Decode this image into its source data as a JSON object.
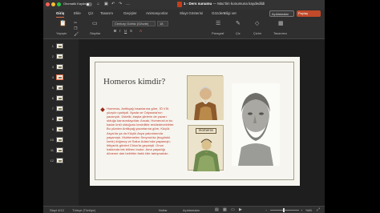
{
  "titlebar": {
    "autosave_label": "Otomatik Kaydet",
    "doc_title": "1 - Ders sunumu",
    "doc_status": "— Mac'tim konumuna kaydedildi"
  },
  "tabs": [
    {
      "label": "Giriş",
      "active": true
    },
    {
      "label": "Ekle"
    },
    {
      "label": "Çiz"
    },
    {
      "label": "Tasarım"
    },
    {
      "label": "Geçişler"
    },
    {
      "label": "Animasyonlar"
    },
    {
      "label": "Slayt Gösterisi"
    },
    {
      "label": "Gözden"
    },
    {
      "label": "Bilgi ver"
    }
  ],
  "tab_buttons": {
    "comments": "Açıklamalar",
    "share": "Paylaş"
  },
  "ribbon": {
    "paste_label": "Yapıştır",
    "slides_label": "Slaytlar",
    "font_name": "Century Gothic (Gövde)",
    "font_size": "18",
    "paragraph_label": "Paragraf",
    "draw_label": "Çiz",
    "drawing_label": "Çizim",
    "designer_label": "Tasarımcı"
  },
  "thumbnails": [
    "1",
    "2",
    "3",
    "4",
    "5",
    "6",
    "7",
    "8",
    "9",
    "10",
    "11",
    "12"
  ],
  "selected_slide": 4,
  "slide": {
    "title": "Homeros kimdir?",
    "bullet_text": "Homeros, Antikçağ insanlarına göre, İÖ VIII. yüzyılın şairiydi. İlyada ve Odysseia'nın yazarıydı. Üstelik, başka şiirlerin de yazarı olduğu kanısındaydılar. Ancak, Homeros'un bu kadar ünlü olduğunu kesinlikle reddedecektirler. Bu yüzden Antikçağ yazarlarına göre, Küçük Asya'da ya da Küçük Asya yakınlarında yaşamıştı. Muhtemelen Smyrna'da (bugünkü İzmir) doğmuş ve Sakız Adası'nda yaşamıştı; ihtiyarlık günleri Chios'ta geçmişti. Onun hakkında tek bilinen budur. Ama yaşadığı döneme dair belirtiler farklı bile tartışmalıdır.",
    "image_label": "Homeros"
  },
  "statusbar": {
    "slide_info": "Slayt 4/12",
    "language": "Türkçe (Türkiye)",
    "notes": "Notlar",
    "comments": "Açıklamalar",
    "zoom": "%80"
  }
}
